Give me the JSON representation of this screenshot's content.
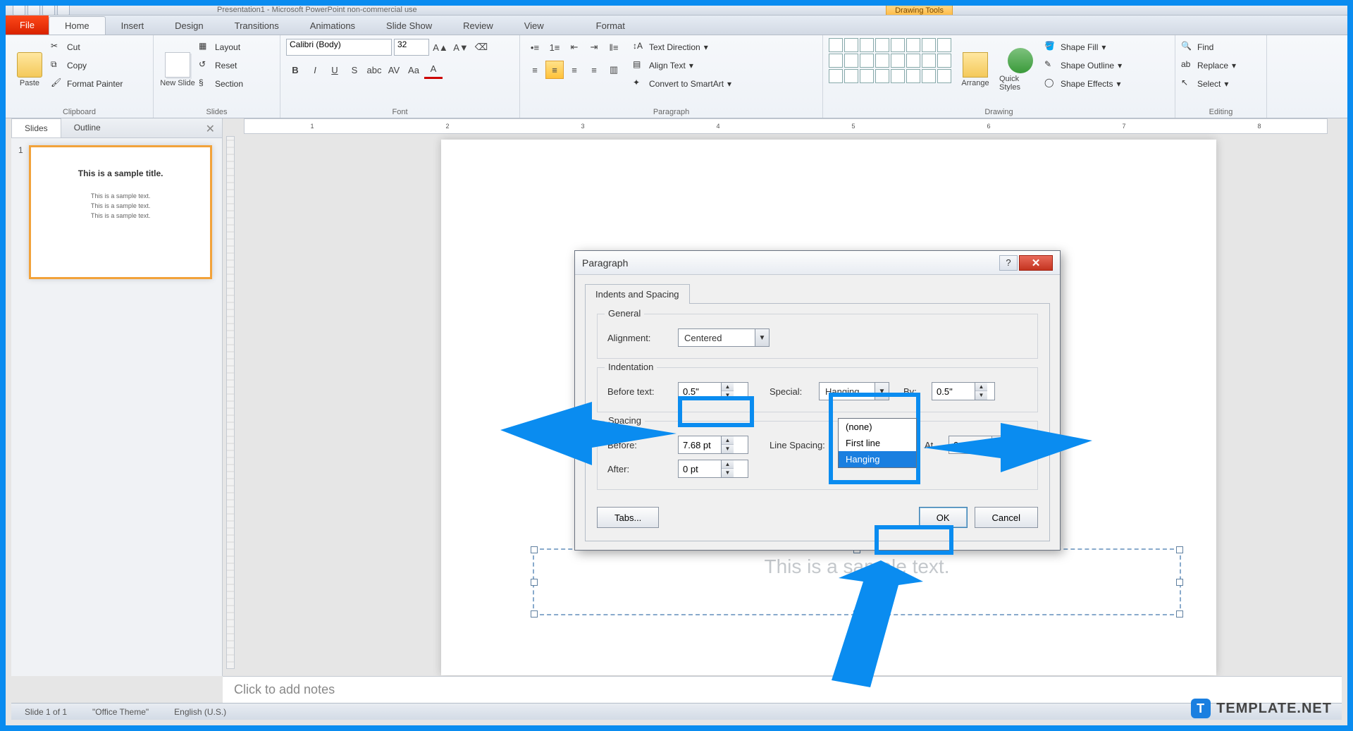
{
  "app": {
    "title": "Presentation1 - Microsoft PowerPoint non-commercial use",
    "drawing_tools": "Drawing Tools"
  },
  "tabs": {
    "file": "File",
    "home": "Home",
    "insert": "Insert",
    "design": "Design",
    "transitions": "Transitions",
    "animations": "Animations",
    "slideshow": "Slide Show",
    "review": "Review",
    "view": "View",
    "format": "Format"
  },
  "ribbon": {
    "clipboard": {
      "label": "Clipboard",
      "paste": "Paste",
      "cut": "Cut",
      "copy": "Copy",
      "format_painter": "Format Painter"
    },
    "slides": {
      "label": "Slides",
      "new_slide": "New Slide",
      "layout": "Layout",
      "reset": "Reset",
      "section": "Section"
    },
    "font": {
      "label": "Font",
      "name": "Calibri (Body)",
      "size": "32"
    },
    "paragraph": {
      "label": "Paragraph",
      "text_direction": "Text Direction",
      "align_text": "Align Text",
      "smartart": "Convert to SmartArt"
    },
    "drawing": {
      "label": "Drawing",
      "arrange": "Arrange",
      "quick_styles": "Quick Styles",
      "shape_fill": "Shape Fill",
      "shape_outline": "Shape Outline",
      "shape_effects": "Shape Effects"
    },
    "editing": {
      "label": "Editing",
      "find": "Find",
      "replace": "Replace",
      "select": "Select"
    }
  },
  "panel": {
    "slides_tab": "Slides",
    "outline_tab": "Outline"
  },
  "thumb": {
    "num": "1",
    "title": "This is a sample title.",
    "text1": "This is a sample text.",
    "text2": "This is a sample text.",
    "text3": "This is a sample text."
  },
  "canvas": {
    "sel_text": "This is a sample text."
  },
  "notes": {
    "placeholder": "Click to add notes"
  },
  "status": {
    "slide": "Slide 1 of 1",
    "theme": "\"Office Theme\"",
    "lang": "English (U.S.)"
  },
  "dialog": {
    "title": "Paragraph",
    "tab": "Indents and Spacing",
    "general": {
      "legend": "General",
      "alignment_label": "Alignment:",
      "alignment_value": "Centered"
    },
    "indentation": {
      "legend": "Indentation",
      "before_text_label": "Before text:",
      "before_text_value": "0.5\"",
      "special_label": "Special:",
      "special_value": "Hanging",
      "by_label": "By:",
      "by_value": "0.5\"",
      "options": {
        "none": "(none)",
        "first_line": "First line",
        "hanging": "Hanging"
      }
    },
    "spacing": {
      "legend": "Spacing",
      "before_label": "Before:",
      "before_value": "7.68 pt",
      "after_label": "After:",
      "after_value": "0 pt",
      "line_spacing_label": "Line Spacing:",
      "at_label": "At",
      "at_value": "0"
    },
    "buttons": {
      "tabs": "Tabs...",
      "ok": "OK",
      "cancel": "Cancel"
    }
  },
  "watermark": {
    "text": "TEMPLATE.NET"
  },
  "ruler": [
    "1",
    "2",
    "3",
    "4",
    "5",
    "6",
    "7",
    "8"
  ]
}
